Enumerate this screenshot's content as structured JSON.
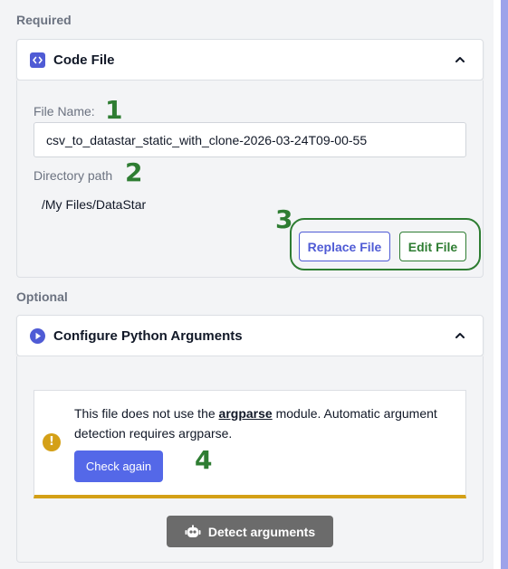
{
  "required_section": {
    "label": "Required",
    "code_file": {
      "title": "Code File",
      "icon": "code-icon",
      "file_name_label": "File Name:",
      "file_name_value": "csv_to_datastar_static_with_clone-2026-03-24T09-00-55",
      "directory_label": "Directory path",
      "directory_value": "/My Files/DataStar",
      "replace_label": "Replace File",
      "edit_label": "Edit File"
    }
  },
  "optional_section": {
    "label": "Optional",
    "python_args": {
      "title": "Configure Python Arguments",
      "icon": "play-circle-icon",
      "notice": {
        "text_before": "This file does not use the ",
        "keyword": "argparse",
        "text_after": " module. Automatic argument detection requires argparse.",
        "check_label": "Check again",
        "warning_glyph": "!"
      },
      "detect_label": "Detect arguments",
      "detect_icon": "robot-icon"
    }
  },
  "annotations": [
    "1",
    "2",
    "3",
    "4"
  ],
  "colors": {
    "accent": "#4f5bd5",
    "annotation_green": "#2e7d32",
    "warning": "#d4a017",
    "check_button": "#5468e8",
    "detect_button": "#6b6b6b",
    "scroll_accent": "#9da3ea"
  }
}
